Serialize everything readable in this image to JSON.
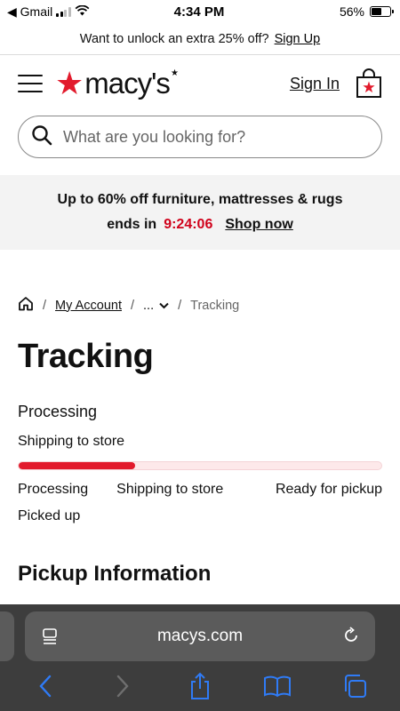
{
  "status_bar": {
    "back_app": "◀ Gmail",
    "time": "4:34 PM",
    "battery": "56%",
    "battery_level": 0.56
  },
  "promo": {
    "text": "Want to unlock an extra 25% off?",
    "link": "Sign Up"
  },
  "header": {
    "logo_text": "macy's",
    "sign_in": "Sign In"
  },
  "search": {
    "placeholder": "What are you looking for?"
  },
  "sale_banner": {
    "headline": "Up to 60% off furniture, mattresses & rugs",
    "ends_label": "ends in",
    "countdown": "9:24:06",
    "cta": "Shop now"
  },
  "breadcrumb": {
    "sep": "/",
    "account": "My Account",
    "more": "...",
    "current": "Tracking"
  },
  "page_title": "Tracking",
  "tracking": {
    "status": "Processing",
    "substatus": "Shipping to store",
    "progress": 0.32,
    "steps": [
      "Processing",
      "Shipping to store",
      "Ready for pickup",
      "Picked up"
    ]
  },
  "pickup_title": "Pickup Information",
  "browser": {
    "url": "macys.com"
  },
  "colors": {
    "brand_red": "#e21a2c",
    "countdown_red": "#d0021b",
    "browser_blue": "#2f7bf6"
  }
}
